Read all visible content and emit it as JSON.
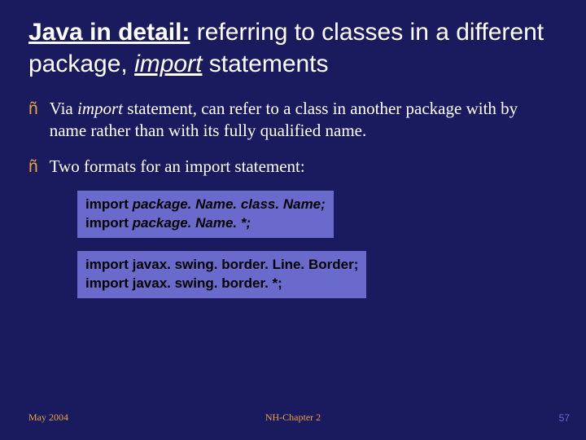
{
  "title": {
    "bold": "Java in detail:",
    "rest1": " referring to classes in a different package, ",
    "italic": "import",
    "rest2": " statements"
  },
  "bullets": [
    {
      "pre": "Via ",
      "italic": "import",
      "post": " statement, can refer to a class in another package with by name rather than with its fully qualified name."
    },
    {
      "pre": "Two formats for an import statement:",
      "italic": "",
      "post": ""
    }
  ],
  "code1": {
    "line1_kw": "import",
    "line1_rest": " package. Name. class. Name;",
    "line2_kw": "import",
    "line2_rest": " package. Name. *;"
  },
  "code2": {
    "line1_kw": "import",
    "line1_rest": " javax. swing. border. Line. Border;",
    "line2_kw": "import",
    "line2_rest": " javax. swing. border. *;"
  },
  "footer": {
    "left": "May 2004",
    "center": "NH-Chapter 2",
    "right": "57"
  },
  "bullet_marker": "ñ"
}
